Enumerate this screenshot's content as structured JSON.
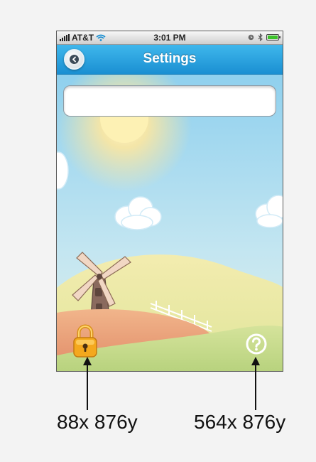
{
  "status_bar": {
    "carrier": "AT&T",
    "time": "3:01 PM"
  },
  "nav": {
    "title": "Settings",
    "back_icon": "chevron-left-icon"
  },
  "settings": {
    "text_field_value": ""
  },
  "controls": {
    "lock_icon": "padlock-icon",
    "help_icon": "question-mark-icon"
  },
  "annotations": {
    "lock_coordinate": "88x 876y",
    "help_coordinate": "564x 876y"
  },
  "colors": {
    "nav_bar": "#1a9be0",
    "sky": "#a9d8ee",
    "hill": "#c5d98a",
    "path": "#e9a27a",
    "lock": "#f4a81e"
  }
}
